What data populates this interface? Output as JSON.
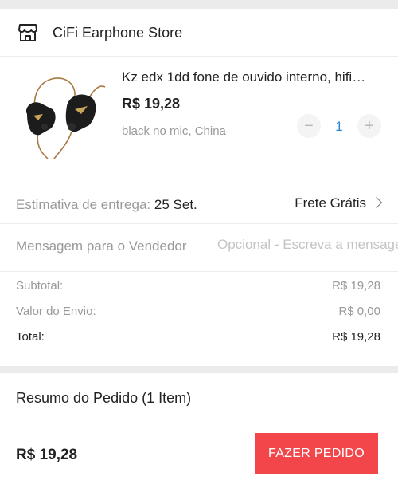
{
  "store": {
    "name": "CiFi Earphone Store",
    "icon": "storefront-icon"
  },
  "product": {
    "image": "earphone-product-image",
    "title": "Kz edx 1dd fone de ouvido interno, hifi…",
    "price": "R$ 19,28",
    "variant": "black no mic, China",
    "quantity": "1",
    "minus_label": "−",
    "plus_label": "+"
  },
  "delivery": {
    "label": "Estimativa de entrega:",
    "date": "25 Set.",
    "shipping": "Frete Grátis"
  },
  "message": {
    "label": "Mensagem para o Vendedor",
    "placeholder": "Opcional - Escreva a mensagem"
  },
  "totals": {
    "subtotal_label": "Subtotal:",
    "subtotal_value": "R$ 19,28",
    "shipping_label": "Valor do Envio:",
    "shipping_value": "R$ 0,00",
    "total_label": "Total:",
    "total_value": "R$ 19,28"
  },
  "summary": {
    "title": "Resumo do Pedido (1 Item)",
    "footer_price": "R$ 19,28",
    "place_order_label": "FAZER PEDIDO"
  },
  "colors": {
    "accent": "#f2464b",
    "quantity": "#2a88d8"
  }
}
